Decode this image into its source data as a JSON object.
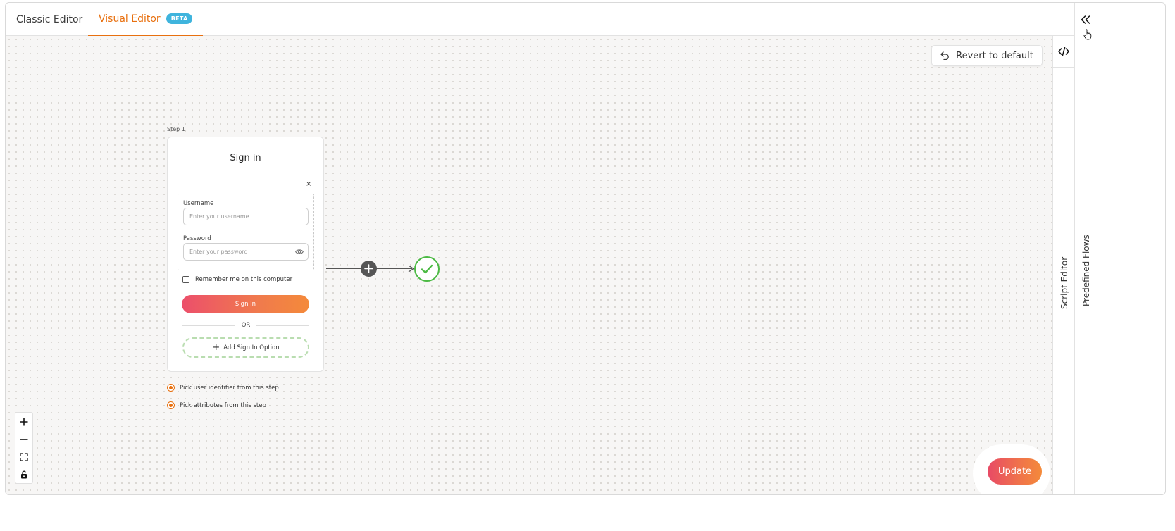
{
  "tabs": {
    "classic": "Classic Editor",
    "visual": "Visual Editor",
    "beta_badge": "BETA"
  },
  "toolbar": {
    "revert_label": "Revert to default"
  },
  "step": {
    "label": "Step 1",
    "title": "Sign in",
    "close": "×",
    "username_label": "Username",
    "username_placeholder": "Enter your username",
    "password_label": "Password",
    "password_placeholder": "Enter your password",
    "remember_label": "Remember me on this computer",
    "signin_button": "Sign In",
    "or_text": "OR",
    "add_option": "Add Sign In Option"
  },
  "options": {
    "pick_identifier": "Pick user identifier from this step",
    "pick_attributes": "Pick attributes from this step"
  },
  "update_button": "Update",
  "side_panels": {
    "script_editor": "Script Editor",
    "predefined_flows": "Predefined Flows"
  },
  "colors": {
    "accent": "#e8700f",
    "beta": "#3fb4dd",
    "success": "#4cba44",
    "gradient_start": "#ec4f6b",
    "gradient_end": "#f48a3a"
  },
  "icons": [
    "undo-icon",
    "close-icon",
    "eye-icon",
    "plus-icon",
    "check-icon",
    "zoom-in-icon",
    "zoom-out-icon",
    "fit-view-icon",
    "lock-icon",
    "code-icon",
    "double-chevron-left-icon"
  ]
}
